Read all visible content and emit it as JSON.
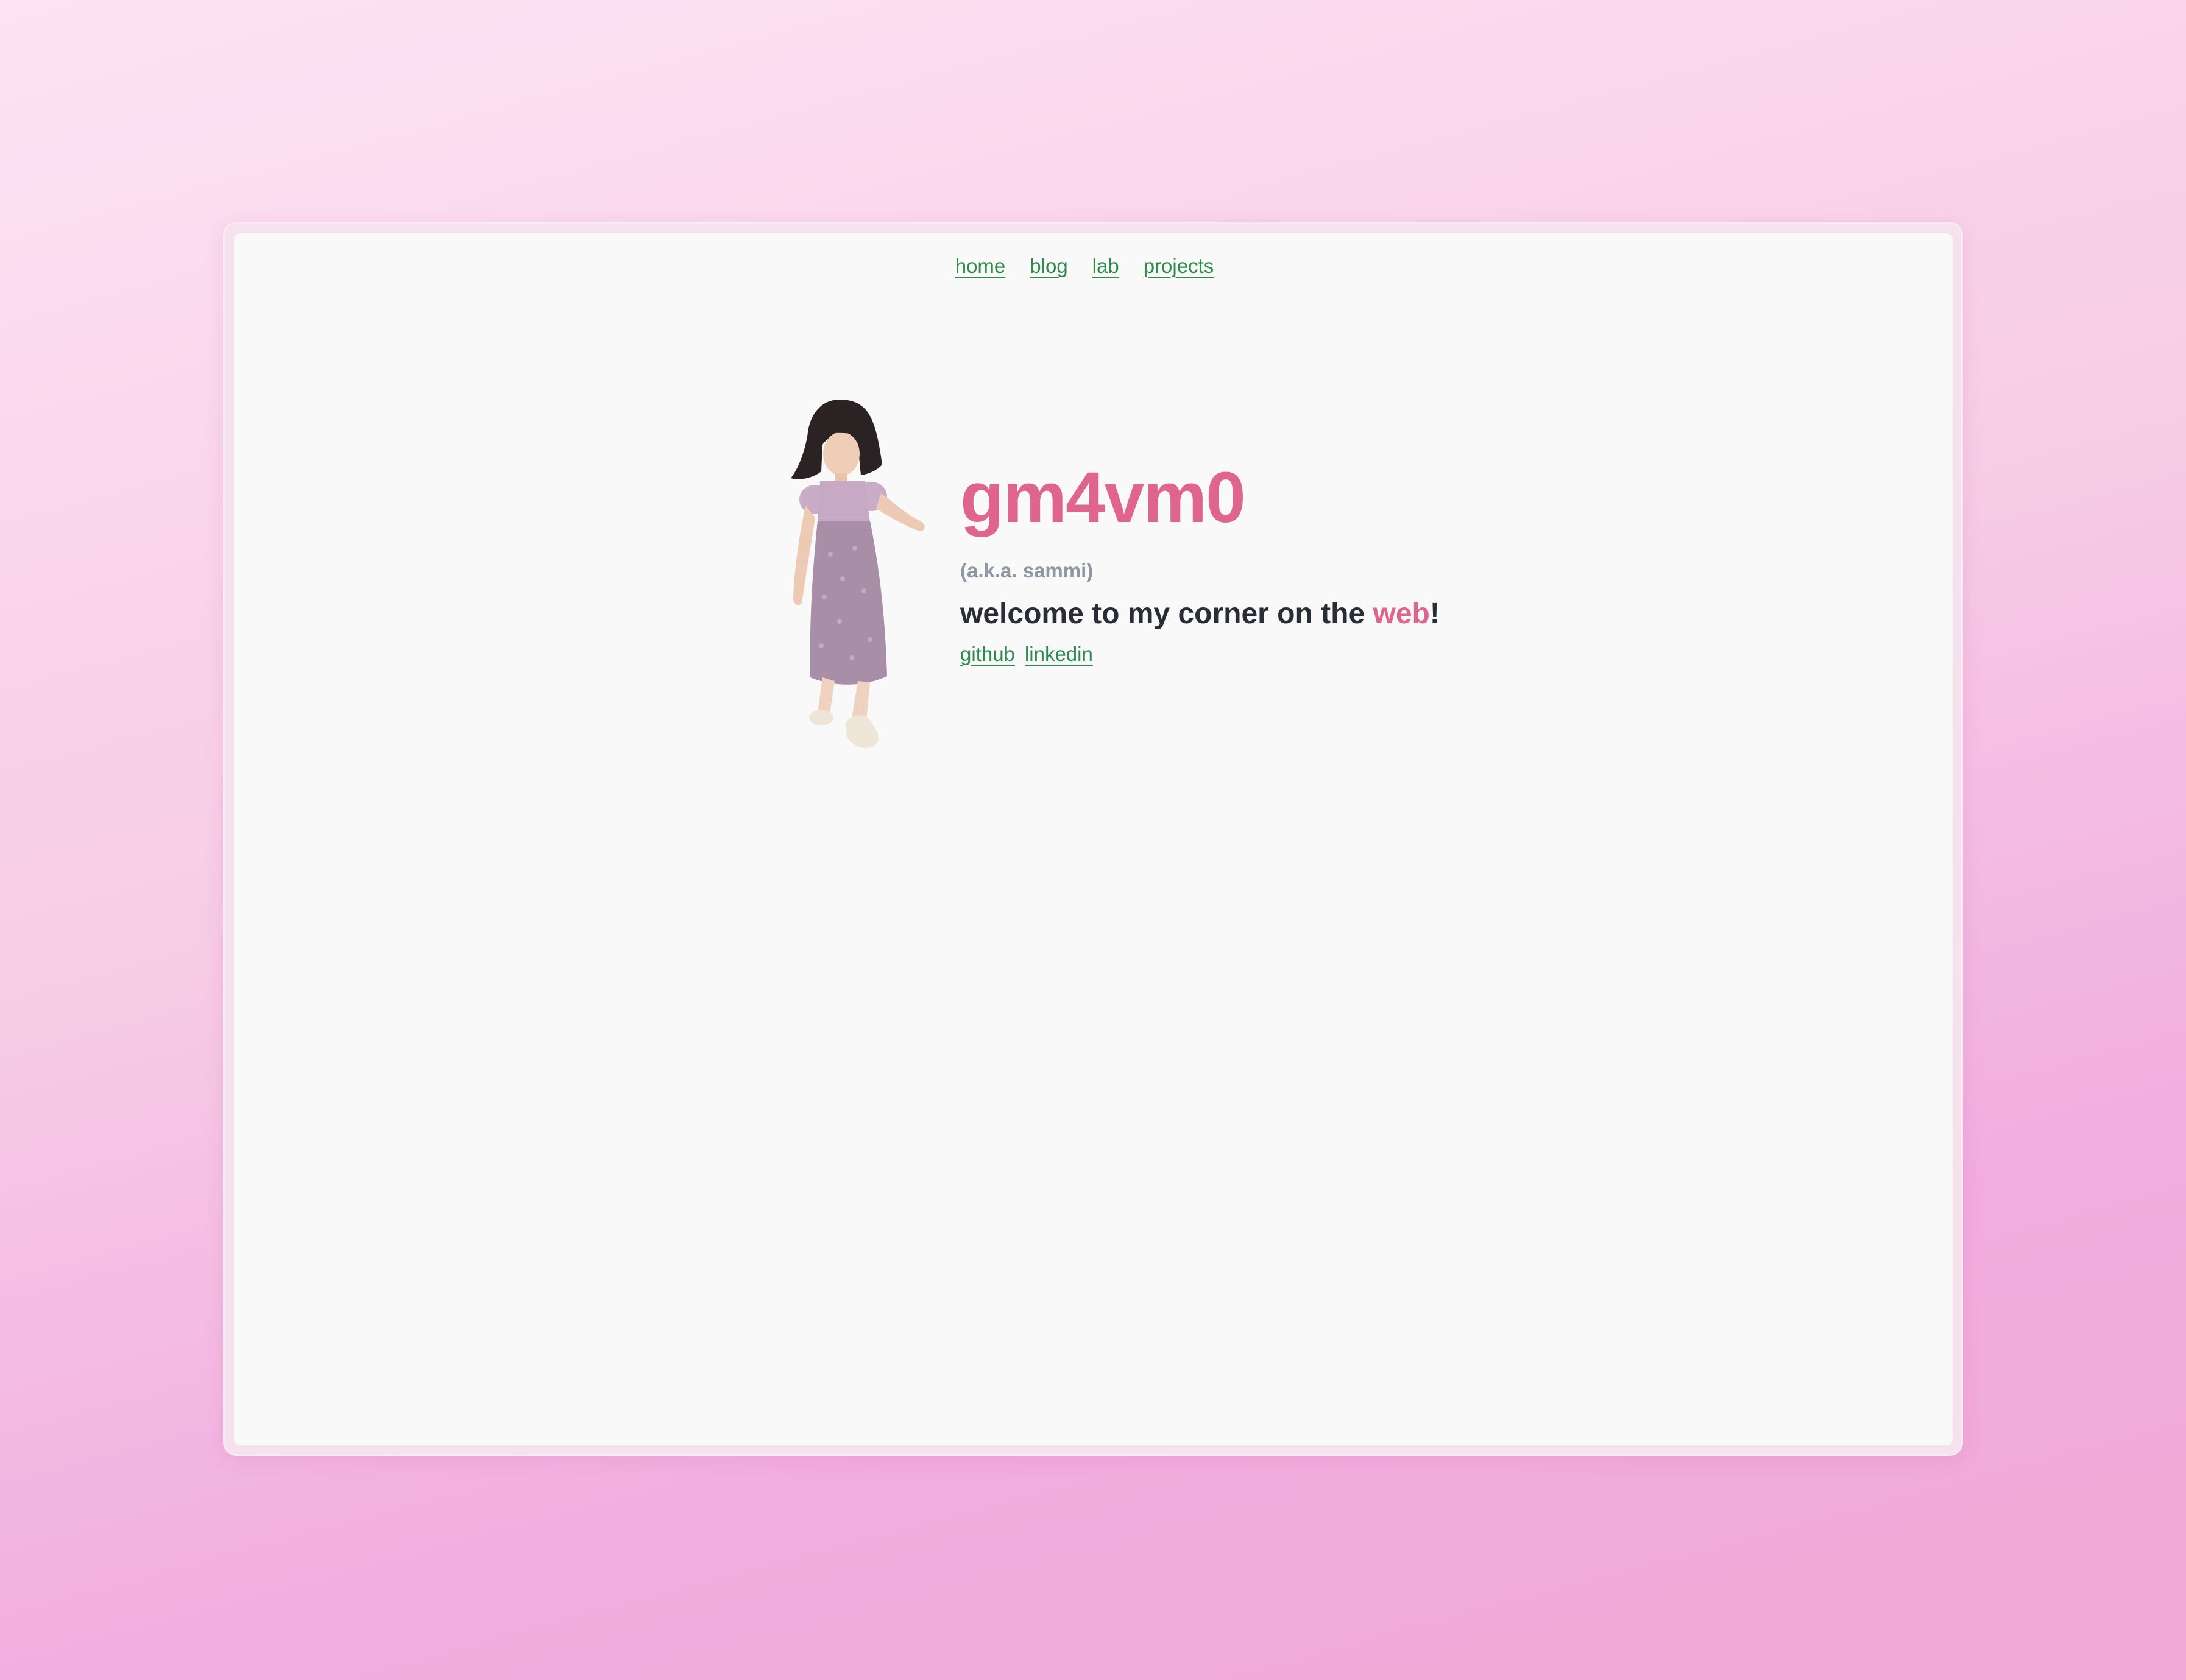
{
  "nav": {
    "items": [
      "home",
      "blog",
      "lab",
      "projects"
    ]
  },
  "hero": {
    "title": "gm4vm0",
    "aka": "(a.k.a. sammi)",
    "welcome_prefix": "welcome to my corner on the ",
    "welcome_accent": "web",
    "welcome_suffix": "!"
  },
  "social": {
    "github": "github",
    "linkedin": "linkedin"
  },
  "colors": {
    "accent": "#e0658e",
    "link": "#2f8a4d",
    "muted": "#8e97a3",
    "text": "#2a2d35",
    "panel": "#f9f9f9"
  },
  "icons": {
    "avatar": "toddler-in-purple-dress-photo"
  }
}
